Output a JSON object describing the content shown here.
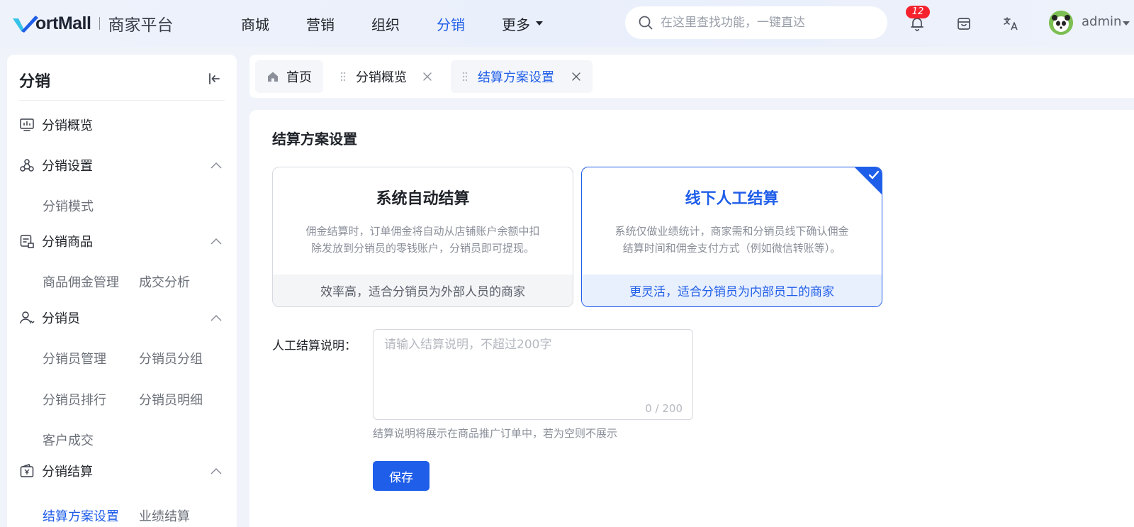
{
  "brand": {
    "logo_text": "ortMall",
    "subtitle": "商家平台",
    "accent": "#1f5ee8"
  },
  "nav": {
    "items": [
      {
        "label": "商城",
        "active": false
      },
      {
        "label": "营销",
        "active": false
      },
      {
        "label": "组织",
        "active": false
      },
      {
        "label": "分销",
        "active": true
      }
    ],
    "more_label": "更多"
  },
  "search": {
    "placeholder": "在这里查找功能，一键直达",
    "icon": "search-icon"
  },
  "header": {
    "notification_count": "12",
    "user_name": "admin"
  },
  "sidebar": {
    "title": "分销",
    "items": [
      {
        "label": "分销概览",
        "icon": "monitor-chart-icon"
      },
      {
        "label": "分销设置",
        "icon": "network-icon",
        "expanded": true,
        "children": [
          "分销模式"
        ]
      },
      {
        "label": "分销商品",
        "icon": "goods-tag-icon",
        "expanded": true,
        "children": [
          "商品佣金管理",
          "成交分析"
        ]
      },
      {
        "label": "分销员",
        "icon": "user-icon",
        "expanded": true,
        "children": [
          "分销员管理",
          "分销员分组",
          "分销员排行",
          "分销员明细",
          "客户成交"
        ]
      },
      {
        "label": "分销结算",
        "icon": "wallet-icon",
        "expanded": true,
        "children": [
          "结算方案设置",
          "业绩结算"
        ]
      }
    ],
    "active_item": "结算方案设置"
  },
  "tabs": {
    "items": [
      {
        "label": "首页",
        "icon": "home-icon",
        "closable": false
      },
      {
        "label": "分销概览",
        "closable": true
      },
      {
        "label": "结算方案设置",
        "closable": true,
        "active": true
      }
    ]
  },
  "main": {
    "title": "结算方案设置",
    "options": [
      {
        "title": "系统自动结算",
        "desc": "佣金结算时，订单佣金将自动从店铺账户余额中扣除发放到分销员的零钱账户，分销员即可提现。",
        "footer": "效率高，适合分销员为外部人员的商家",
        "selected": false
      },
      {
        "title": "线下人工结算",
        "desc": "系统仅做业绩统计，商家需和分销员线下确认佣金结算时间和佣金支付方式（例如微信转账等）。",
        "footer": "更灵活，适合分销员为内部员工的商家",
        "selected": true
      }
    ],
    "field": {
      "label": "人工结算说明：",
      "placeholder": "请输入结算说明，不超过200字",
      "value": "",
      "counter": "0 / 200",
      "hint": "结算说明将展示在商品推广订单中，若为空则不展示"
    },
    "save_label": "保存"
  }
}
